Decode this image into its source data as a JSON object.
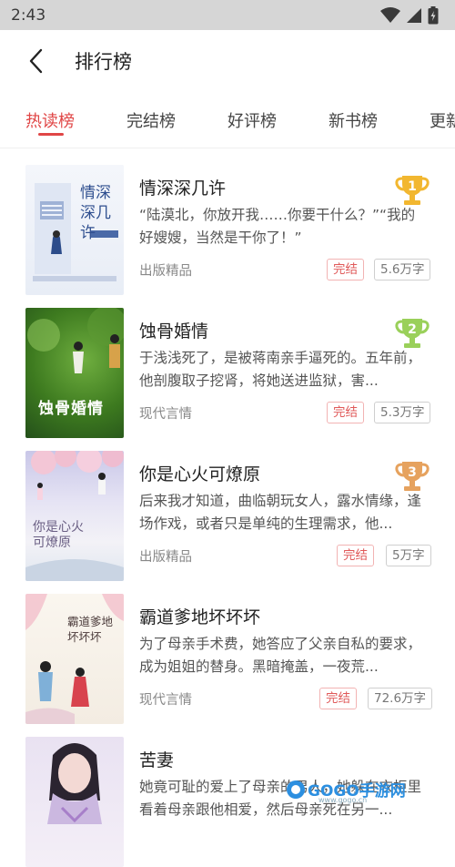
{
  "status": {
    "time": "2:43"
  },
  "header": {
    "title": "排行榜"
  },
  "tabs": [
    {
      "label": "热读榜",
      "active": true
    },
    {
      "label": "完结榜",
      "active": false
    },
    {
      "label": "好评榜",
      "active": false
    },
    {
      "label": "新书榜",
      "active": false
    },
    {
      "label": "更新",
      "active": false
    }
  ],
  "books": [
    {
      "title": "情深深几许",
      "desc": "“陆漠北，你放开我……你要干什么？”“我的好嫂嫂，当然是干你了！”",
      "category": "出版精品",
      "status": "完结",
      "words": "5.6万字",
      "rank": "1",
      "cover_text": "情深 深几许"
    },
    {
      "title": "蚀骨婚情",
      "desc": "于浅浅死了，是被蒋南亲手逼死的。五年前，他剖腹取子挖肾，将她送进监狱，害...",
      "category": "现代言情",
      "status": "完结",
      "words": "5.3万字",
      "rank": "2",
      "cover_text": "蚀骨婚情"
    },
    {
      "title": "你是心火可燎原",
      "desc": "后来我才知道，曲临朝玩女人，露水情缘，逢场作戏，或者只是单纯的生理需求，他...",
      "category": "出版精品",
      "status": "完结",
      "words": "5万字",
      "rank": "3",
      "cover_text": "你是心火 可燎原"
    },
    {
      "title": "霸道爹地坏坏坏",
      "desc": "为了母亲手术费，她答应了父亲自私的要求，成为姐姐的替身。黑暗掩盖，一夜荒...",
      "category": "现代言情",
      "status": "完结",
      "words": "72.6万字",
      "rank": "",
      "cover_text": "霸道爹地 坏坏坏"
    },
    {
      "title": "苦妻",
      "desc": "她竟可耻的爱上了母亲的男人，她躲在衣柜里看着母亲跟他相爱，然后母亲死在另一...",
      "category": "",
      "status": "",
      "words": "",
      "rank": "",
      "cover_text": ""
    }
  ],
  "watermark": {
    "brand": "GOGO手游网",
    "url": "www.gogo.cn"
  },
  "colors": {
    "accent": "#e04646",
    "gold": "#f2b730",
    "green": "#9ad05a",
    "bronze": "#e6a25e",
    "status_bar": "#d6d6d6"
  }
}
